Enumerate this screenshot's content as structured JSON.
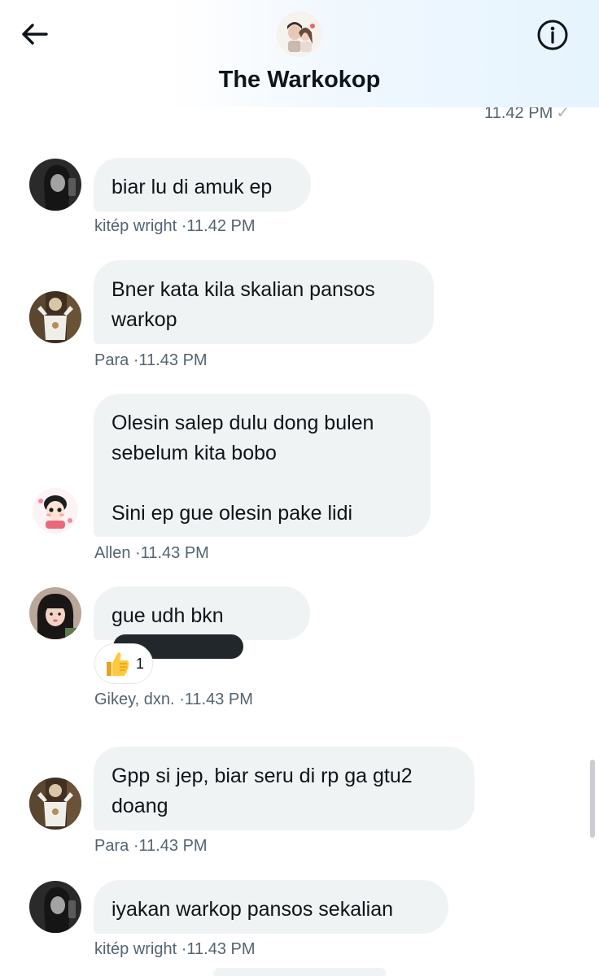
{
  "header": {
    "title": "The Warkokop",
    "back_icon": "arrow-left-icon",
    "info_icon": "info-circle-icon",
    "last_sent_time": "11.42 PM"
  },
  "messages": [
    {
      "sender": "kitép wright",
      "time": "·11.42 PM",
      "text": "biar lu di amuk ep",
      "avatar": "dark-portrait"
    },
    {
      "sender": "Para",
      "time": "·11.43 PM",
      "text": "Bner kata kila skalian pansos\nwarkop",
      "avatar": "tshirt-figure"
    },
    {
      "sender": "Allen",
      "time": "·11.43 PM",
      "text": "Olesin salep dulu dong bulen\nsebelum kita bobo\n\nSini ep gue olesin pake lidi",
      "avatar": "cartoon-girl"
    },
    {
      "sender": "Gikey, dxn.",
      "time": "·11.43 PM",
      "text": "gue udh bkn",
      "avatar": "girl-portrait",
      "reaction": {
        "emoji": "thumbs-up-icon",
        "count": "1"
      }
    },
    {
      "sender": "Para",
      "time": "·11.43 PM",
      "text": "Gpp si jep, biar seru di rp ga gtu2\ndoang",
      "avatar": "tshirt-figure"
    },
    {
      "sender": "kitép wright",
      "time": "·11.43 PM",
      "text": "iyakan warkop pansos sekalian",
      "avatar": "dark-portrait"
    }
  ],
  "colors": {
    "bubble": "#eff3f4",
    "meta_text": "#536471",
    "title_text": "#0f1419",
    "redaction": "#22272b"
  }
}
